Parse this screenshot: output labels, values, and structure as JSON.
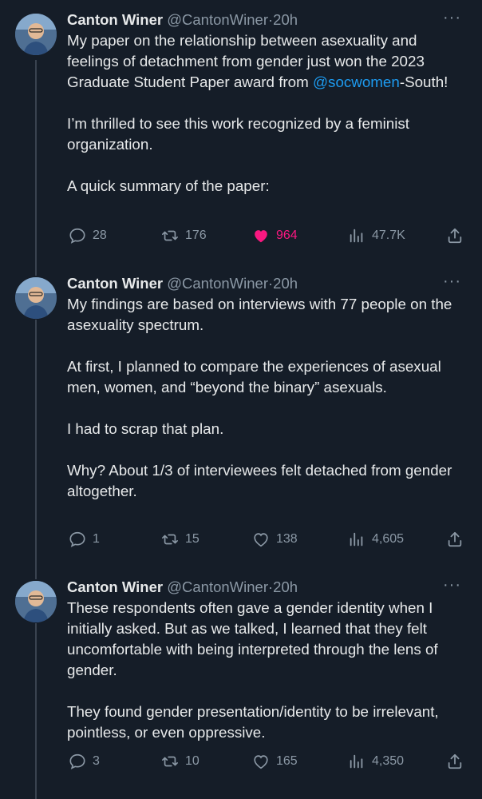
{
  "tweets": [
    {
      "author": "Canton Winer",
      "handle": "@CantonWiner",
      "dot": "·",
      "time": "20h",
      "more": "···",
      "paragraphs": [
        "My paper on the relationship between asexuality and feelings of detachment from gender just won the 2023 Graduate Student Paper award from ",
        "I’m thrilled to see this work recognized by a feminist organization.",
        "A quick summary of the paper:"
      ],
      "mention": "@socwomen",
      "mention_suffix": "-South!",
      "replies": "28",
      "reposts": "176",
      "likes": "964",
      "views": "47.7K",
      "liked": true
    },
    {
      "author": "Canton Winer",
      "handle": "@CantonWiner",
      "dot": "·",
      "time": "20h",
      "more": "···",
      "paragraphs": [
        "My findings are based on interviews with 77 people on the asexuality spectrum.",
        "At first, I planned to compare the experiences of asexual men, women, and “beyond the binary” asexuals.",
        "I had to scrap that plan.",
        "Why? About 1/3 of interviewees felt detached from gender altogether."
      ],
      "replies": "1",
      "reposts": "15",
      "likes": "138",
      "views": "4,605",
      "liked": false
    },
    {
      "author": "Canton Winer",
      "handle": "@CantonWiner",
      "dot": "·",
      "time": "20h",
      "more": "···",
      "paragraphs": [
        "These respondents often gave a gender identity when I initially asked. But as we talked, I learned that they felt uncomfortable with being interpreted through the lens of gender.",
        "They found gender presentation/identity to be irrelevant, pointless, or even oppressive."
      ],
      "replies": "3",
      "reposts": "10",
      "likes": "165",
      "views": "4,350",
      "liked": false
    }
  ],
  "colors": {
    "background": "#151d28",
    "text": "#e7e9ea",
    "muted": "#8b98a5",
    "accent": "#1d9bf0",
    "like": "#f91880"
  },
  "icons": [
    "reply-icon",
    "repost-icon",
    "like-icon",
    "views-icon",
    "share-icon",
    "more-icon"
  ]
}
